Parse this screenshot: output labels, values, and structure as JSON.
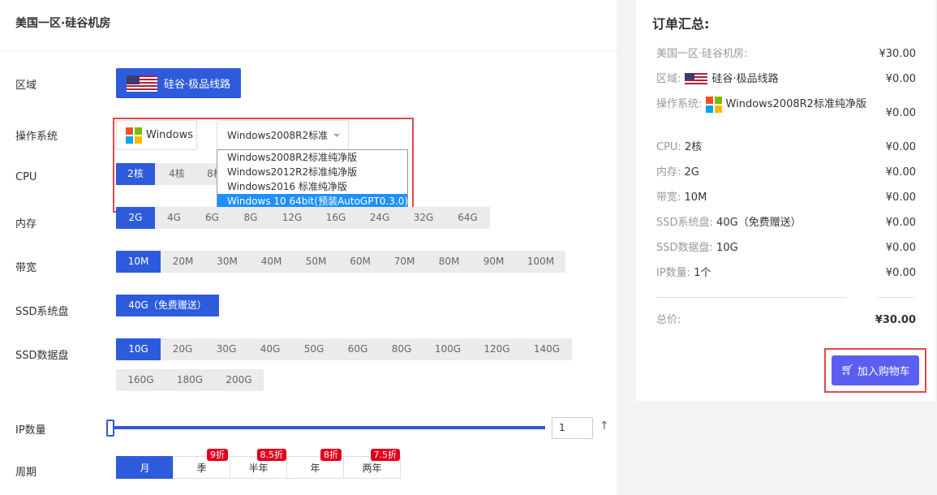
{
  "page_title": "美国一区·硅谷机房",
  "labels": {
    "region": "区域",
    "os": "操作系统",
    "cpu": "CPU",
    "memory": "内存",
    "bandwidth": "带宽",
    "ssd_system": "SSD系统盘",
    "ssd_data": "SSD数据盘",
    "ip_count": "IP数量",
    "period": "周期"
  },
  "region": {
    "button_label": "硅谷·极品线路",
    "icon": "us-flag-icon"
  },
  "os": {
    "family_label": "Windows",
    "family_icon": "windows-icon",
    "selected": "Windows2008R2标准",
    "options": [
      "Windows2008R2标准纯净版",
      "Windows2012R2标准纯净版",
      "Windows2016 标准纯净版",
      "Windows 10 64bit(预装AutoGPT0.3.0)"
    ],
    "highlighted_index": 3
  },
  "cpu": {
    "options": [
      "2核",
      "4核",
      "8核"
    ],
    "selected_index": 0
  },
  "memory": {
    "options": [
      "2G",
      "4G",
      "6G",
      "8G",
      "12G",
      "16G",
      "24G",
      "32G",
      "64G"
    ],
    "selected_index": 0
  },
  "bandwidth": {
    "options": [
      "10M",
      "20M",
      "30M",
      "40M",
      "50M",
      "60M",
      "70M",
      "80M",
      "90M",
      "100M"
    ],
    "selected_index": 0
  },
  "ssd_system": {
    "options": [
      "40G（免费赠送）"
    ],
    "selected_index": 0
  },
  "ssd_data": {
    "options": [
      "10G",
      "20G",
      "30G",
      "40G",
      "50G",
      "60G",
      "80G",
      "100G",
      "120G",
      "140G",
      "160G",
      "180G",
      "200G"
    ],
    "selected_index": 0
  },
  "ip": {
    "value": "1",
    "slider_fraction": 0.0,
    "up_icon": "arrow-up-icon"
  },
  "period": {
    "options": [
      {
        "label": "月",
        "badge": ""
      },
      {
        "label": "季",
        "badge": "9折"
      },
      {
        "label": "半年",
        "badge": "8.5折"
      },
      {
        "label": "年",
        "badge": "8折"
      },
      {
        "label": "两年",
        "badge": "7.5折"
      }
    ],
    "selected_index": 0
  },
  "summary": {
    "title": "订单汇总:",
    "rows": [
      {
        "label": "美国一区·硅谷机房:",
        "value": "",
        "price": "¥30.00"
      },
      {
        "label": "区域:",
        "value": "硅谷·极品线路",
        "icon": "us-flag-icon",
        "price": "¥0.00"
      },
      {
        "label": "操作系统:",
        "value": "Windows2008R2标准纯净版",
        "icon": "windows-icon",
        "price": "¥0.00"
      },
      {
        "label": "CPU:",
        "value": "2核",
        "price": "¥0.00"
      },
      {
        "label": "内存:",
        "value": "2G",
        "price": "¥0.00"
      },
      {
        "label": "带宽:",
        "value": "10M",
        "price": "¥0.00"
      },
      {
        "label": "SSD系统盘:",
        "value": "40G（免费赠送）",
        "price": "¥0.00"
      },
      {
        "label": "SSD数据盘:",
        "value": "10G",
        "price": "¥0.00"
      },
      {
        "label": "IP数量:",
        "value": "1个",
        "price": "¥0.00"
      }
    ],
    "total_label": "总价:",
    "total_price": "¥30.00",
    "cart_button": "加入购物车",
    "cart_icon": "cart-icon"
  },
  "colors": {
    "primary": "#2e5bdc",
    "cart": "#5a5ff2",
    "highlight_box": "#e04848",
    "badge": "#e0001b"
  }
}
